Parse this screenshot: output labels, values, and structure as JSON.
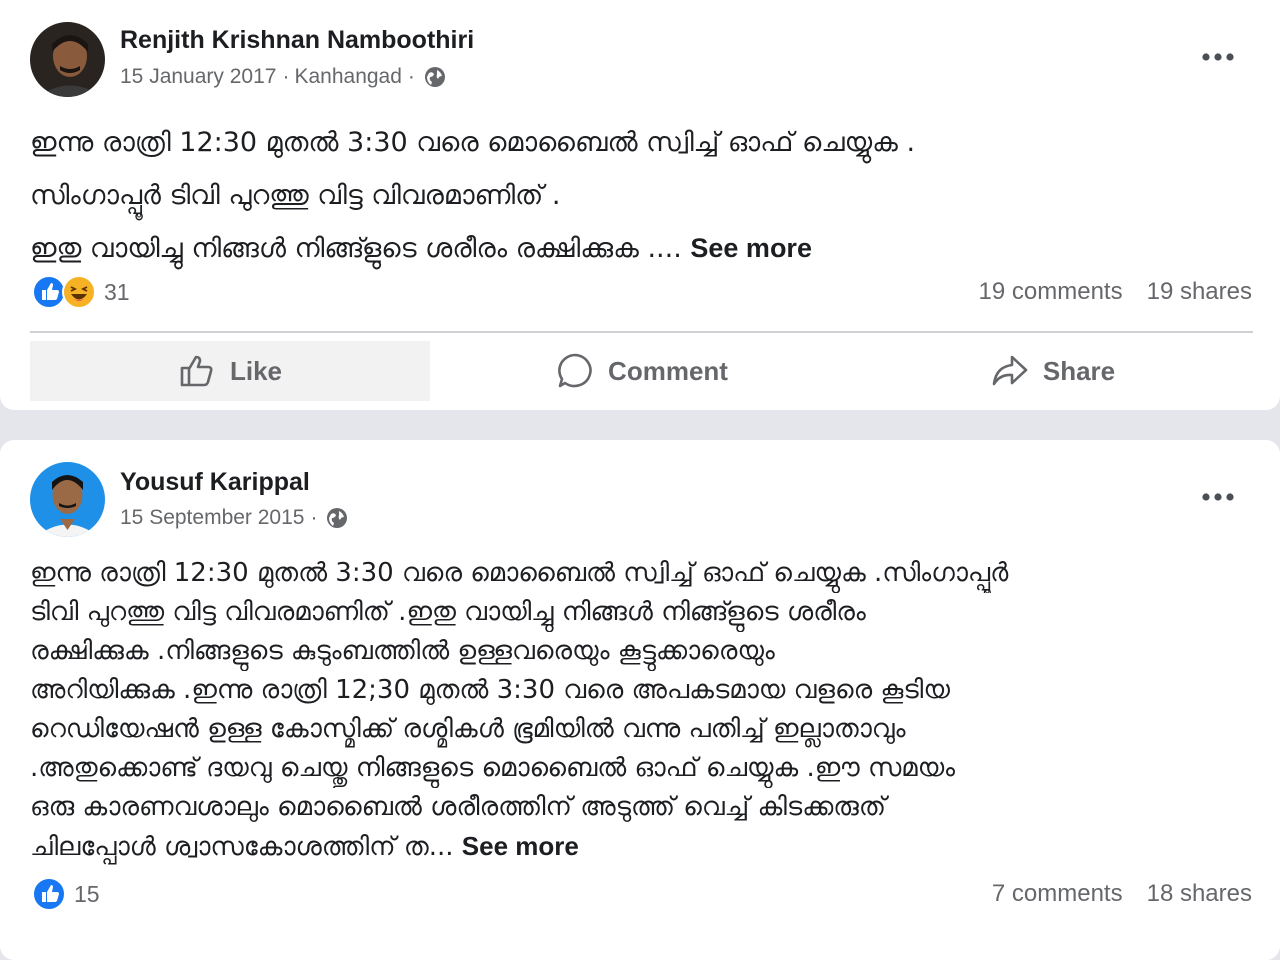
{
  "posts": [
    {
      "author": "Renjith Krishnan Namboothiri",
      "date": "15 January 2017",
      "location": "Kanhangad",
      "separator": "·",
      "body_lines": [
        "ഇന്നു രാത്രി 12:30 മുതൽ 3:30 വരെ മൊബൈൽ സ്വിച്ച് ഓഫ് ചെയ്യുക .",
        "സിംഗാപ്പൂർ ടിവി പുറത്തു വിട്ട വിവരമാണിത് .",
        "ഇതു വായിച്ചു നിങ്ങൾ നിങ്ങ്ളുടെ ശരീരം രക്ഷിക്കുക .... "
      ],
      "see_more": "See more",
      "reactions": [
        "like-icon",
        "haha-icon"
      ],
      "reaction_count": "31",
      "comments": "19 comments",
      "shares": "19 shares"
    },
    {
      "author": "Yousuf Karippal",
      "date": "15 September 2015",
      "separator": "·",
      "body_lines": [
        "ഇന്നു രാത്രി 12:30 മുതൽ 3:30 വരെ മൊബൈൽ സ്വിച്ച് ഓഫ് ചെയ്യുക .സിംഗാപ്പൂർ",
        "ടിവി പുറത്തു വിട്ട വിവരമാണിത് .ഇതു വായിച്ചു നിങ്ങൾ നിങ്ങ്ളുടെ ശരീരം",
        "രക്ഷിക്കുക .നിങ്ങളുടെ കുടുംബത്തിൽ ഉള്ളവരെയും കൂട്ടുക്കാരെയും",
        "അറിയിക്കുക .ഇന്നു രാത്രി 12;30 മുതൽ 3:30 വരെ അപകടമായ വളരെ കൂടിയ",
        "റെഡിയേഷൻ ഉള്ള കോസ്മിക്ക് രശ്മികൾ ഭൂമിയിൽ വന്നു പതിച്ച് ഇല്ലാതാവും",
        ".അതുക്കൊണ്ട് ദയവു ചെയ്തു നിങ്ങളുടെ മൊബൈൽ ഓഫ് ചെയ്യുക  .ഈ സമയം",
        "ഒരു  കാരണവശാലും മൊബൈൽ ശരീരത്തിന് അടുത്ത് വെച്ച് കിടക്കരുത്",
        "ചിലപ്പോൾ ശ്വാസകോശത്തിന് ത... "
      ],
      "see_more": "See more",
      "reactions": [
        "like-icon"
      ],
      "reaction_count": "15",
      "comments": "7 comments",
      "shares": "18 shares"
    }
  ],
  "actions": {
    "like": "Like",
    "comment": "Comment",
    "share": "Share"
  },
  "colors": {
    "facebook_blue": "#1877f2",
    "haha_yellow": "#f7b125",
    "secondary_text": "#65676b"
  }
}
